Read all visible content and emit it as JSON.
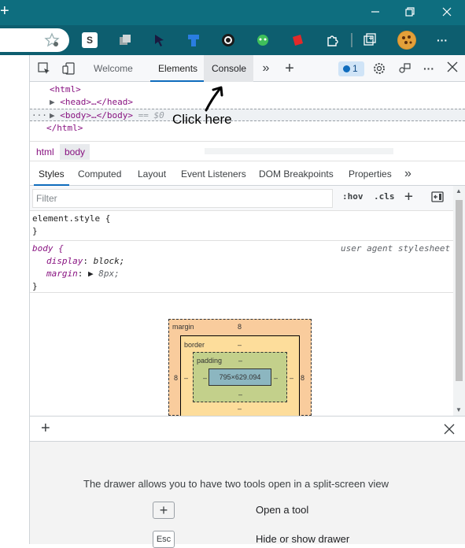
{
  "browser": {
    "new_tab_icon": "plus-icon",
    "window_controls": [
      "minimize-icon",
      "restore-icon",
      "close-icon"
    ],
    "extensions": [
      {
        "name": "favorites-star-icon"
      },
      {
        "name": "s-extension-icon",
        "label": "S"
      },
      {
        "name": "collections-icon"
      },
      {
        "name": "cursor-extension-icon"
      },
      {
        "name": "blue-extension-icon"
      },
      {
        "name": "circle-extension-icon"
      },
      {
        "name": "green-extension-icon"
      },
      {
        "name": "red-extension-icon"
      },
      {
        "name": "puzzle-extensions-icon"
      },
      {
        "name": "collections-add-icon"
      },
      {
        "name": "profile-avatar"
      },
      {
        "name": "more-menu-icon",
        "label": "···"
      }
    ]
  },
  "devtools": {
    "tabs": [
      {
        "label": "Welcome"
      },
      {
        "label": "Elements"
      },
      {
        "label": "Console"
      }
    ],
    "more_tabs": "»",
    "add_tab": "+",
    "issues_count": "1",
    "dom": {
      "html_open": "<html>",
      "head_collapsed": "<head>…</head>",
      "body_collapsed": "<body>…</body>",
      "body_eq": "== $0",
      "html_close": "</html>",
      "dots": "···"
    },
    "annotation": "Click here",
    "breadcrumbs": [
      "html",
      "body"
    ],
    "subtabs": [
      "Styles",
      "Computed",
      "Layout",
      "Event Listeners",
      "DOM Breakpoints",
      "Properties"
    ],
    "subtabs_more": "»",
    "filter_placeholder": "Filter",
    "hov": ":hov",
    "cls": ".cls",
    "rules": {
      "element_style": "element.style {",
      "element_close": "}",
      "body_selector": "body {",
      "source": "user agent stylesheet",
      "decl1_prop": "display",
      "decl1_val": "block;",
      "decl2_prop": "margin",
      "decl2_val": "8px;",
      "body_close": "}"
    },
    "box_model": {
      "margin_label": "margin",
      "margin_top": "8",
      "margin_left": "8",
      "margin_right": "8",
      "border_label": "border",
      "border_top": "–",
      "border_left": "–",
      "border_right": "–",
      "border_bottom": "–",
      "padding_label": "padding",
      "padding_top": "–",
      "padding_left": "–",
      "padding_right": "–",
      "padding_bottom": "–",
      "content": "795×629.094"
    },
    "drawer": {
      "add_icon": "+",
      "message": "The drawer allows you to have two tools open in a split-screen view",
      "open_tool": "Open a tool",
      "hide_show": "Hide or show drawer",
      "esc_key": "Esc"
    }
  },
  "colors": {
    "titlebar": "#0e6e7f",
    "toolbar": "#0d5e6f",
    "accent": "#0f6cbd",
    "margin_box": "#f9cc9d",
    "border_box": "#fddd9b",
    "padding_box": "#c3d08b",
    "content_box": "#8cb6c0"
  }
}
